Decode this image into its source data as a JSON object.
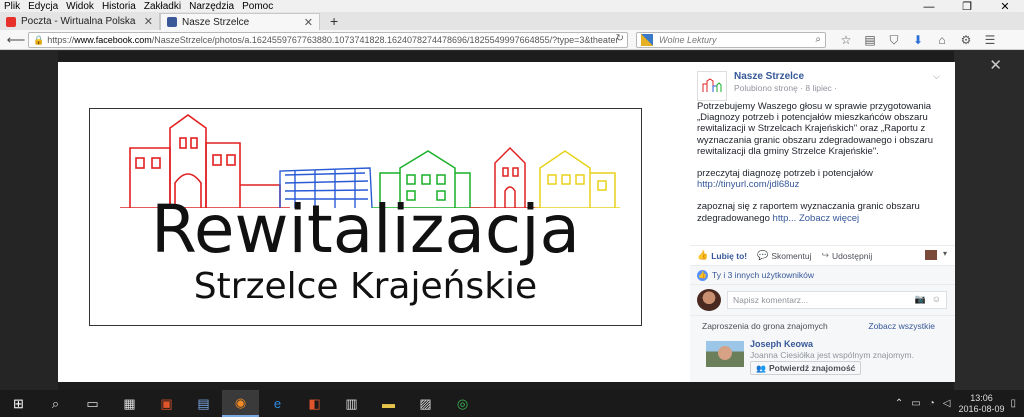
{
  "menu": [
    "Plik",
    "Edycja",
    "Widok",
    "Historia",
    "Zakładki",
    "Narzędzia",
    "Pomoc"
  ],
  "window_controls": {
    "minimize": "—",
    "restore": "❐",
    "close": "✕"
  },
  "tabs": [
    {
      "label": "Poczta - Wirtualna Polska",
      "icon": "wp-icon",
      "color": "#e8302a"
    },
    {
      "label": "Nasze Strzelce",
      "icon": "facebook-icon",
      "color": "#3b5998"
    }
  ],
  "new_tab": "+",
  "url": {
    "scheme": "https://",
    "domain": "www.facebook.com",
    "path": "/NaszeStrzelce/photos/a.1624559767763880.1073741828.1624078274478696/1825549997664855/?type=3&theater"
  },
  "search": {
    "placeholder": "Wolne Lektury"
  },
  "photo": {
    "title": "Rewitalizacja",
    "subtitle": "Strzelce Krajeńskie"
  },
  "post": {
    "page_name": "Nasze Strzelce",
    "meta": "Polubiono stronę · 8 lipiec ·",
    "paragraphs": [
      "Potrzebujemy Waszego głosu w sprawie przygotowania „Diagnozy potrzeb i potencjałów mieszkańców obszaru rewitalizacji w Strzelcach Krajeńskich\" oraz „Raportu z wyznaczania granic obszaru zdegradowanego i obszaru rewitalizacji dla gminy Strzelce Krajeńskie\".",
      "przeczytaj diagnozę potrzeb i potencjałów"
    ],
    "link": "http://tinyurl.com/jdl68uz",
    "para3": "zapoznaj się z raportem wyznaczania granic obszaru zdegradowanego",
    "para3_link": "http...",
    "see_more": "Zobacz więcej"
  },
  "actions": {
    "like": "Lubię to!",
    "comment": "Skomentuj",
    "share": "Udostępnij"
  },
  "likes": "Ty i 3 innych użytkowników",
  "comment_placeholder": "Napisz komentarz...",
  "friends": {
    "heading": "Zaproszenia do grona znajomych",
    "see_all": "Zobacz wszystkie",
    "name": "Joseph Keowa",
    "mutual": "Joanna Ciesiółka jest wspólnym znajomym.",
    "confirm": "Potwierdź znajomość"
  },
  "clock": {
    "time": "13:06",
    "date": "2016-08-09"
  }
}
